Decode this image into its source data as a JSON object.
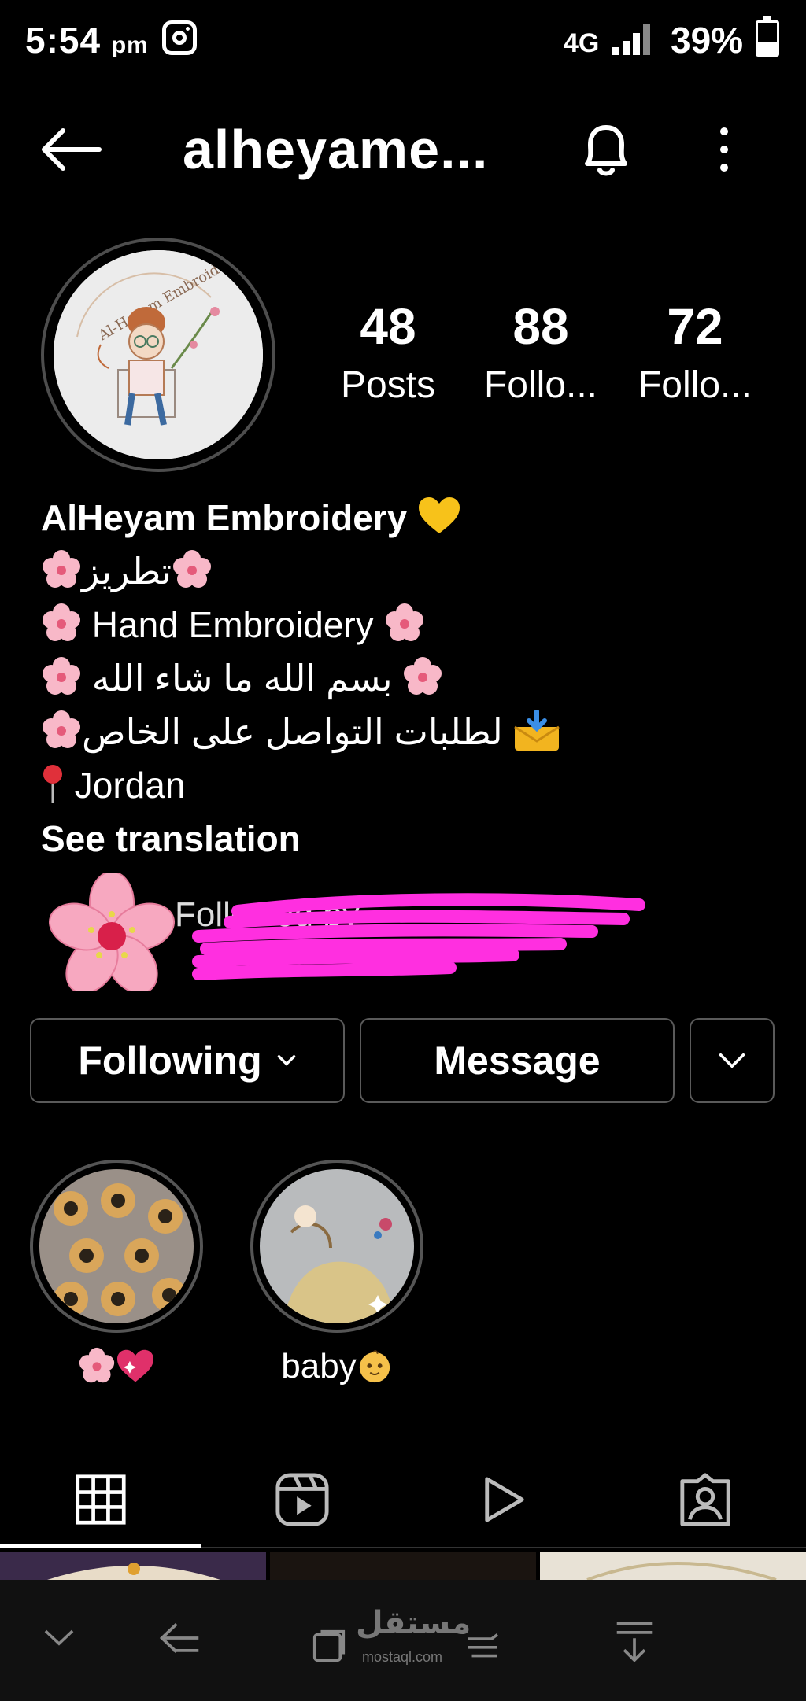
{
  "status_bar": {
    "time": "5:54",
    "ampm": "pm",
    "network": "4G",
    "battery": "39%"
  },
  "header": {
    "handle": "alheyame..."
  },
  "stats": [
    {
      "value": "48",
      "label": "Posts"
    },
    {
      "value": "88",
      "label": "Follo..."
    },
    {
      "value": "72",
      "label": "Follo..."
    }
  ],
  "bio": {
    "name": "AlHeyam Embroidery",
    "line_tatreez": "تطريز",
    "line_hand": "Hand Embroidery",
    "line_bism": "بسم الله ما شاء الله",
    "line_orders": "لطلبات التواصل على الخاص",
    "location": "Jordan",
    "see_translation": "See translation"
  },
  "followed_by": {
    "text": "Followed by"
  },
  "buttons": {
    "following": "Following",
    "message": "Message"
  },
  "highlights": [
    {
      "caption": ""
    },
    {
      "caption": "baby"
    }
  ],
  "watermark": {
    "name": "مستقل",
    "domain": "mostaql.com"
  },
  "colors": {
    "background": "#000000",
    "text": "#ffffff",
    "border": "#5a5a5a",
    "scribble": "#ff2fe0"
  }
}
